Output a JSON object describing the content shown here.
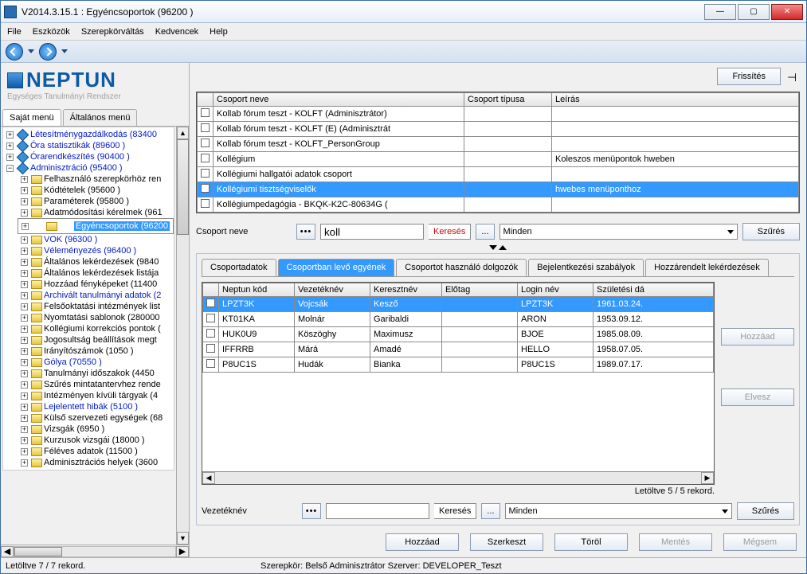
{
  "window_title": "V2014.3.15.1 : Egyéncsoportok (96200  )",
  "menu": {
    "file": "File",
    "tools": "Eszközök",
    "role": "Szerepkörváltás",
    "fav": "Kedvencek",
    "help": "Help"
  },
  "logo": {
    "name": "NEPTUN",
    "sub": "Egységes Tanulmányi Rendszer"
  },
  "lefttabs": {
    "own": "Saját menü",
    "gen": "Általános menü"
  },
  "tree": {
    "n1": "Létesítménygazdálkodás (83400",
    "n2": "Óra statisztikák (89600  )",
    "n3": "Órarendkészítés (90400  )",
    "n4": "Adminisztráció (95400  )",
    "n4a": "Felhasználó szerepkörhöz ren",
    "n4b": "Kódtételek (95600  )",
    "n4c": "Paraméterek (95800  )",
    "n4d": "Adatmódosítási kérelmek (961",
    "n4e": "Egyéncsoportok (96200",
    "n4f": "VOK (96300  )",
    "n4g": "Véleményezés (96400  )",
    "n4h": "Általános lekérdezések (9840",
    "n4i": "Általános lekérdezések listája",
    "n4j": "Hozzáad fényképeket (11400",
    "n4k": "Archivált tanulmányi adatok (2",
    "n4l": "Felsőoktatási intézmények list",
    "n4m": "Nyomtatási sablonok (280000",
    "n4n": "Kollégiumi korrekciós pontok (",
    "n4o": "Jogosultság beállítások megt",
    "n4p": "Irányítószámok (1050  )",
    "n4q": "Gólya (70550  )",
    "n4r": "Tanulmányi időszakok (4450",
    "n4s": "Szűrés mintatantervhez rende",
    "n4t": "Intézményen kívüli tárgyak (4",
    "n4u": "Lejelentett hibák (5100  )",
    "n4v": "Külső szervezeti egységek (68",
    "n4w": "Vizsgák (6950  )",
    "n4x": "Kurzusok vizsgái (18000  )",
    "n4y": "Féléves adatok (11500  )",
    "n4z": "Adminisztrációs helyek (3600"
  },
  "refresh": "Frissítés",
  "groups": {
    "headers": {
      "name": "Csoport neve",
      "type": "Csoport típusa",
      "desc": "Leírás"
    },
    "rows": [
      {
        "name": "Kollab fórum teszt - KOLFT (Adminisztrátor)",
        "type": "",
        "desc": ""
      },
      {
        "name": "Kollab fórum teszt - KOLFT (E) (Adminisztrát",
        "type": "",
        "desc": ""
      },
      {
        "name": "Kollab fórum teszt - KOLFT_PersonGroup",
        "type": "",
        "desc": ""
      },
      {
        "name": "Kollégium",
        "type": "",
        "desc": "Koleszos menüpontok hweben"
      },
      {
        "name": "Kollégiumi hallgatói adatok csoport",
        "type": "",
        "desc": ""
      },
      {
        "name": "Kollégiumi tisztségviselők",
        "type": "",
        "desc": "hwebes menüponthoz"
      },
      {
        "name": "Kollégiumpedagógia - BKQK-K2C-80634G (",
        "type": "",
        "desc": ""
      }
    ]
  },
  "search1": {
    "label": "Csoport neve",
    "value": "koll",
    "btn": "Keresés",
    "dots": "...",
    "all": "Minden",
    "filter": "Szűrés"
  },
  "innertabs": {
    "t1": "Csoportadatok",
    "t2": "Csoportban levő egyének",
    "t3": "Csoportot használó dolgozók",
    "t4": "Bejelentkezési szabályok",
    "t5": "Hozzárendelt lekérdezések"
  },
  "members": {
    "headers": {
      "code": "Neptun kód",
      "last": "Vezetéknév",
      "first": "Keresztnév",
      "prefix": "Előtag",
      "login": "Login név",
      "birth": "Születési dá"
    },
    "rows": [
      {
        "code": "LPZT3K",
        "last": "Vojcsák",
        "first": "Kesző",
        "prefix": "",
        "login": "LPZT3K",
        "birth": "1961.03.24."
      },
      {
        "code": "KT01KA",
        "last": "Molnár",
        "first": "Garibaldi",
        "prefix": "",
        "login": "ARON",
        "birth": "1953.09.12."
      },
      {
        "code": "HUK0U9",
        "last": "Köszöghy",
        "first": "Maximusz",
        "prefix": "",
        "login": "BJOE",
        "birth": "1985.08.09."
      },
      {
        "code": "IFFRRB",
        "last": "Márá",
        "first": "Amadé",
        "prefix": "",
        "login": "HELLO",
        "birth": "1958.07.05."
      },
      {
        "code": "P8UC1S",
        "last": "Hudák",
        "first": "Bianka",
        "prefix": "",
        "login": "P8UC1S",
        "birth": "1989.07.17."
      }
    ],
    "info": "Letöltve 5 / 5 rekord."
  },
  "sideadd": "Hozzáad",
  "sideremove": "Elvesz",
  "search2": {
    "label": "Vezetéknév",
    "value": "",
    "btn": "Keresés",
    "dots": "...",
    "all": "Minden",
    "filter": "Szűrés"
  },
  "actions": {
    "add": "Hozzáad",
    "edit": "Szerkeszt",
    "del": "Töröl",
    "save": "Mentés",
    "cancel": "Mégsem"
  },
  "status": {
    "left": "Letöltve 7 / 7 rekord.",
    "mid": "Szerepkör: Belső Adminisztrátor   Szerver: DEVELOPER_Teszt"
  },
  "chart_data": null
}
